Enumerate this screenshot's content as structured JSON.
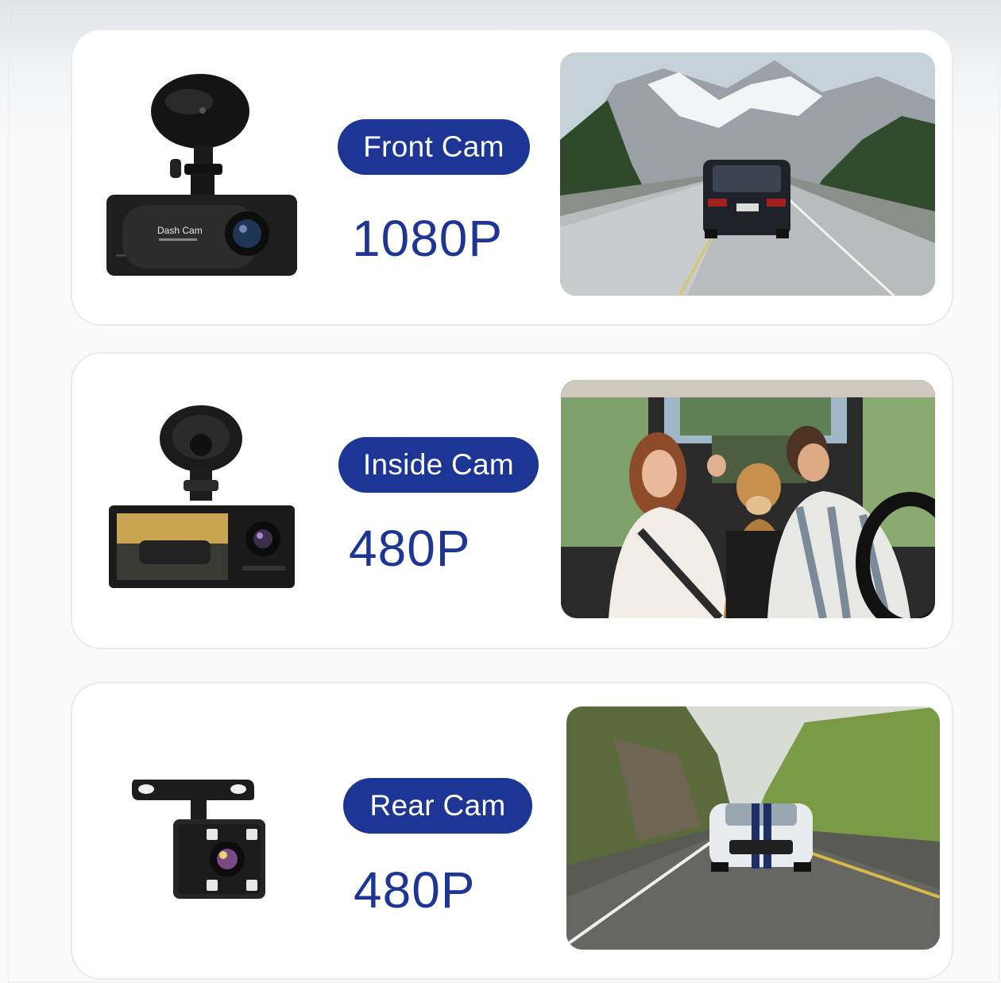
{
  "cards": [
    {
      "label": "Front Cam",
      "resolution": "1080P",
      "device_icon": "dash-cam-front-icon",
      "device_text": "Dash Cam",
      "photo": "mountain-road-suv-photo"
    },
    {
      "label": "Inside Cam",
      "resolution": "480P",
      "device_icon": "dash-cam-inside-icon",
      "photo": "car-interior-family-dog-photo"
    },
    {
      "label": "Rear Cam",
      "resolution": "480P",
      "device_icon": "rear-camera-icon",
      "photo": "road-sports-car-photo"
    }
  ],
  "colors": {
    "accent": "#1d3594",
    "card_bg": "#ffffff",
    "page_bg": "#fafafa"
  }
}
